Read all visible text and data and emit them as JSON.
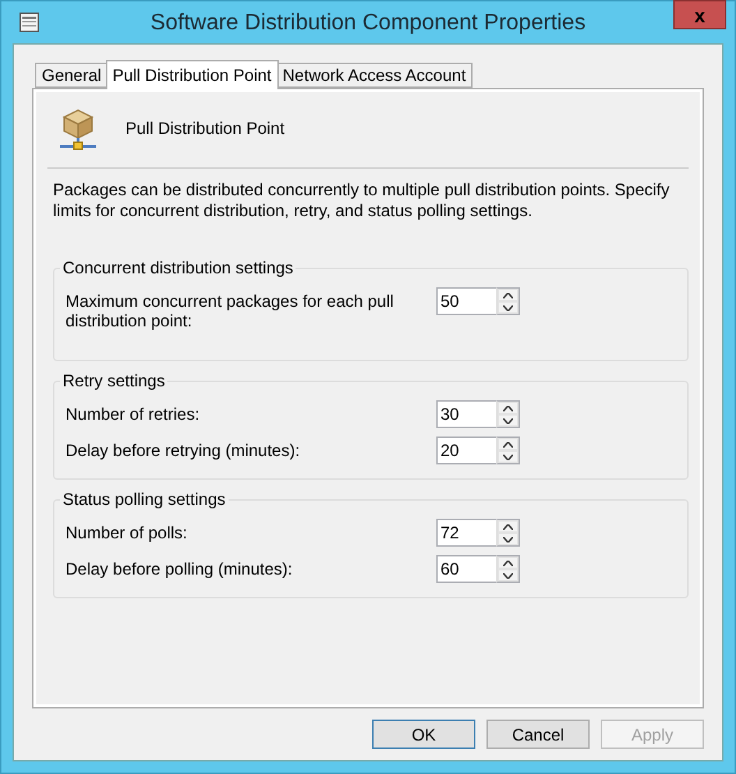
{
  "window": {
    "title": "Software Distribution Component Properties",
    "close": "x"
  },
  "tabs": [
    {
      "label": "General",
      "selected": false
    },
    {
      "label": "Pull Distribution Point",
      "selected": true
    },
    {
      "label": "Network Access Account",
      "selected": false
    }
  ],
  "header": {
    "title": "Pull Distribution Point"
  },
  "description": "Packages can be distributed concurrently to multiple pull distribution points. Specify limits for concurrent distribution, retry, and status polling settings.",
  "groups": [
    {
      "title": "Concurrent distribution settings",
      "fields": [
        {
          "label": "Maximum concurrent packages for each pull distribution point:",
          "value": "50"
        }
      ]
    },
    {
      "title": "Retry settings",
      "fields": [
        {
          "label": "Number of retries:",
          "value": "30"
        },
        {
          "label": "Delay before retrying (minutes):",
          "value": "20"
        }
      ]
    },
    {
      "title": "Status polling settings",
      "fields": [
        {
          "label": "Number of polls:",
          "value": "72"
        },
        {
          "label": "Delay before polling (minutes):",
          "value": "60"
        }
      ]
    }
  ],
  "buttons": [
    {
      "label": "OK",
      "kind": "default",
      "disabled": false
    },
    {
      "label": "Cancel",
      "kind": "normal",
      "disabled": false
    },
    {
      "label": "Apply",
      "kind": "normal",
      "disabled": true
    }
  ]
}
